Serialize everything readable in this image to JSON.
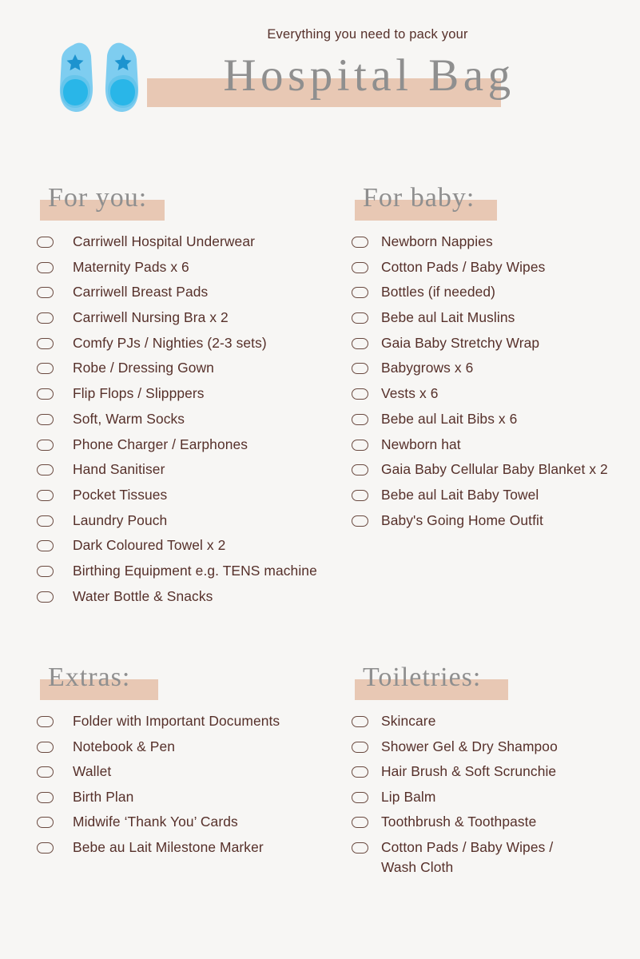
{
  "header": {
    "subtitle": "Everything you need to pack your",
    "title": "Hospital Bag",
    "icon": "baby-booties-icon",
    "bar_color": "#e8c8b4",
    "title_color": "#8f8f8f",
    "text_color": "#56302a",
    "bootie_outer_color": "#7ecdf0",
    "bootie_inner_color": "#29b6e8",
    "bootie_star_color": "#1c93cf"
  },
  "page": {
    "background_color": "#f7f6f4",
    "checkbox_color": "#6a4a40"
  },
  "sections": [
    {
      "id": "for-you",
      "title": "For you:",
      "items": [
        "Carriwell Hospital Underwear",
        "Maternity Pads x 6",
        "Carriwell Breast Pads",
        "Carriwell Nursing Bra x 2",
        "Comfy PJs / Nighties (2-3 sets)",
        "Robe / Dressing Gown",
        "Flip Flops / Slipppers",
        "Soft, Warm Socks",
        "Phone Charger / Earphones",
        "Hand Sanitiser",
        "Pocket Tissues",
        "Laundry Pouch",
        "Dark Coloured Towel x 2",
        "Birthing Equipment e.g. TENS machine",
        "Water Bottle & Snacks"
      ]
    },
    {
      "id": "for-baby",
      "title": "For baby:",
      "items": [
        "Newborn Nappies",
        "Cotton Pads / Baby Wipes",
        "Bottles (if needed)",
        "Bebe aul Lait Muslins",
        "Gaia Baby Stretchy Wrap",
        "Babygrows x 6",
        "Vests x 6",
        "Bebe aul Lait Bibs x 6",
        "Newborn hat",
        "Gaia Baby Cellular Baby Blanket x 2",
        "Bebe aul Lait Baby Towel",
        "Baby's Going Home Outfit"
      ]
    },
    {
      "id": "extras",
      "title": "Extras:",
      "items": [
        "Folder with Important Documents",
        "Notebook & Pen",
        "Wallet",
        "Birth Plan",
        "Midwife ‘Thank You’ Cards",
        "Bebe au Lait Milestone Marker"
      ]
    },
    {
      "id": "toiletries",
      "title": "Toiletries:",
      "items": [
        "Skincare",
        "Shower Gel & Dry Shampoo",
        "Hair Brush & Soft Scrunchie",
        "Lip Balm",
        "Toothbrush & Toothpaste",
        "Cotton Pads / Baby Wipes / Wash Cloth"
      ]
    }
  ]
}
